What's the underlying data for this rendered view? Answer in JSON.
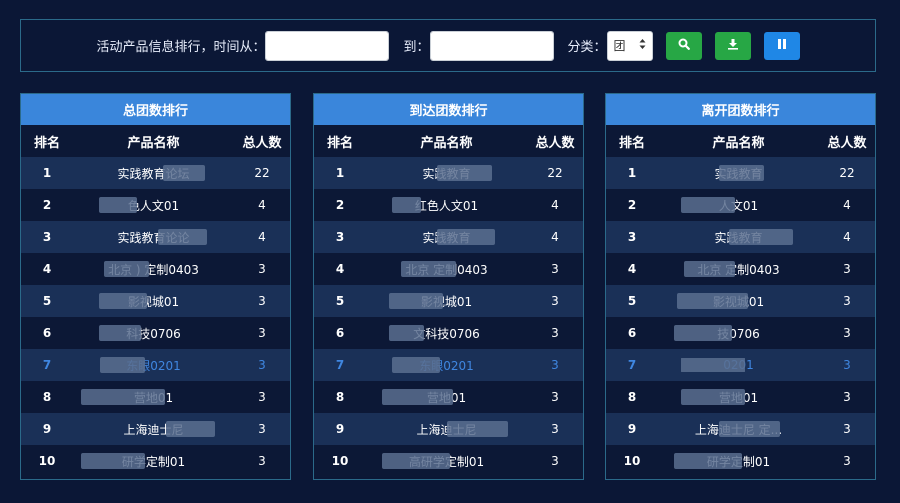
{
  "filter": {
    "label_from": "活动产品信息排行，时间从：",
    "date_from_placeholder": "",
    "label_to": "到：",
    "date_to_placeholder": "",
    "label_category": "分类：",
    "category_value": "团"
  },
  "headers": {
    "rank": "排名",
    "name": "产品名称",
    "count": "总人数"
  },
  "panels": [
    {
      "title": "总团数排行",
      "rows": [
        {
          "rank": "1",
          "name": "实践教育论坛",
          "count": "22"
        },
        {
          "rank": "2",
          "name": "色人文01",
          "count": "4"
        },
        {
          "rank": "3",
          "name": "实践教育论论",
          "count": "4"
        },
        {
          "rank": "4",
          "name": "北京          ) 定制0403",
          "count": "3"
        },
        {
          "rank": "5",
          "name": "影视城01",
          "count": "3"
        },
        {
          "rank": "6",
          "name": "科技0706",
          "count": "3"
        },
        {
          "rank": "7",
          "name": "东眼0201",
          "count": "3"
        },
        {
          "rank": "8",
          "name": "营地01",
          "count": "3"
        },
        {
          "rank": "9",
          "name": "上海迪士尼",
          "count": "3"
        },
        {
          "rank": "10",
          "name": "研学定制01",
          "count": "3"
        }
      ]
    },
    {
      "title": "到达团数排行",
      "rows": [
        {
          "rank": "1",
          "name": "实践教育",
          "count": "22"
        },
        {
          "rank": "2",
          "name": "红色人文01",
          "count": "4"
        },
        {
          "rank": "3",
          "name": "实践教育",
          "count": "4"
        },
        {
          "rank": "4",
          "name": "北京              定制0403",
          "count": "3"
        },
        {
          "rank": "5",
          "name": "影视城01",
          "count": "3"
        },
        {
          "rank": "6",
          "name": "文科技0706",
          "count": "3"
        },
        {
          "rank": "7",
          "name": "东眼0201",
          "count": "3"
        },
        {
          "rank": "8",
          "name": "营地01",
          "count": "3"
        },
        {
          "rank": "9",
          "name": "上海迪士尼",
          "count": "3"
        },
        {
          "rank": "10",
          "name": "高研学定制01",
          "count": "3"
        }
      ]
    },
    {
      "title": "离开团数排行",
      "rows": [
        {
          "rank": "1",
          "name": "实践教育",
          "count": "22"
        },
        {
          "rank": "2",
          "name": "人文01",
          "count": "4"
        },
        {
          "rank": "3",
          "name": "实践教育",
          "count": "4"
        },
        {
          "rank": "4",
          "name": "北京              定制0403",
          "count": "3"
        },
        {
          "rank": "5",
          "name": "影视城01",
          "count": "3"
        },
        {
          "rank": "6",
          "name": "技0706",
          "count": "3"
        },
        {
          "rank": "7",
          "name": "0201",
          "count": "3"
        },
        {
          "rank": "8",
          "name": "营地01",
          "count": "3"
        },
        {
          "rank": "9",
          "name": "上海迪士尼            定...",
          "count": "3"
        },
        {
          "rank": "10",
          "name": "研学定制01",
          "count": "3"
        }
      ]
    }
  ],
  "colors": {
    "background": "#0b1736",
    "header_blue": "#3a86db",
    "row_odd": "#1a3057",
    "row_even": "#0c1836",
    "highlight_text": "#3f86e0",
    "border": "#2b6a8a",
    "btn_green": "#27a745",
    "btn_blue": "#1f87e6"
  },
  "icons": {
    "calendar": "calendar-icon",
    "search": "search-icon",
    "download": "download-icon",
    "pause": "pause-icon",
    "select": "sort-caret-icon"
  }
}
